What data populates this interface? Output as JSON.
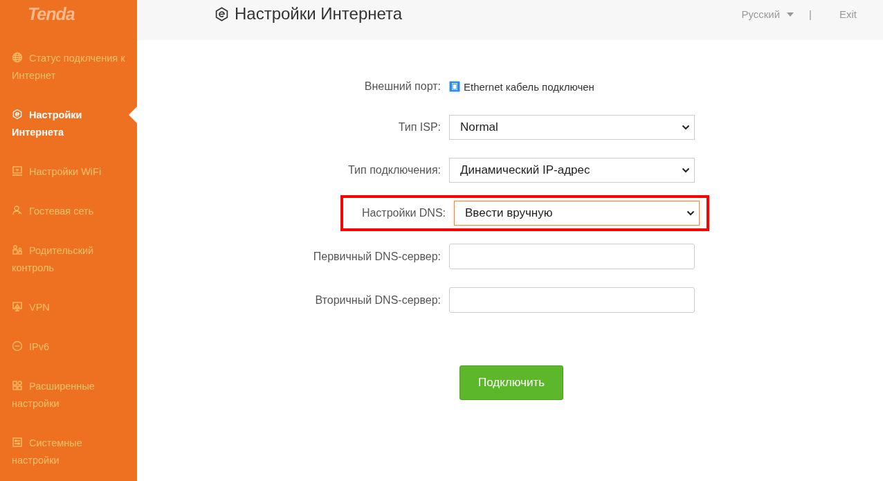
{
  "logo": "Tenda",
  "sidebar": {
    "items": [
      {
        "label": "Статус подклчения к Интернет",
        "selected": false
      },
      {
        "label": "Настройки Интернета",
        "selected": true
      },
      {
        "label": "Настройки WiFi",
        "selected": false
      },
      {
        "label": "Гостевая сеть",
        "selected": false
      },
      {
        "label": "Родительский контроль",
        "selected": false
      },
      {
        "label": "VPN",
        "selected": false
      },
      {
        "label": "IPv6",
        "selected": false
      },
      {
        "label": "Расширенные настройки",
        "selected": false
      },
      {
        "label": "Системные настройки",
        "selected": false
      }
    ]
  },
  "header": {
    "title": "Настройки Интернета",
    "language": "Русский",
    "separator": "|",
    "exit": "Exit"
  },
  "form": {
    "fields": [
      {
        "kind": "status",
        "label": "Внешний порт:",
        "value": "Ethernet кабель подключен",
        "highlighted": false
      },
      {
        "kind": "select",
        "label": "Тип ISP:",
        "value": "Normal",
        "highlighted": false
      },
      {
        "kind": "select",
        "label": "Тип подключения:",
        "value": "Динамический IP-адрес",
        "highlighted": false
      },
      {
        "kind": "select",
        "label": "Настройки DNS:",
        "value": "Ввести вручную",
        "highlighted": true
      },
      {
        "kind": "input",
        "label": "Первичный DNS-сервер:",
        "highlighted": false
      },
      {
        "kind": "input",
        "label": "Вторичный DNS-сервер:",
        "highlighted": false
      }
    ],
    "submit": "Подключить"
  }
}
